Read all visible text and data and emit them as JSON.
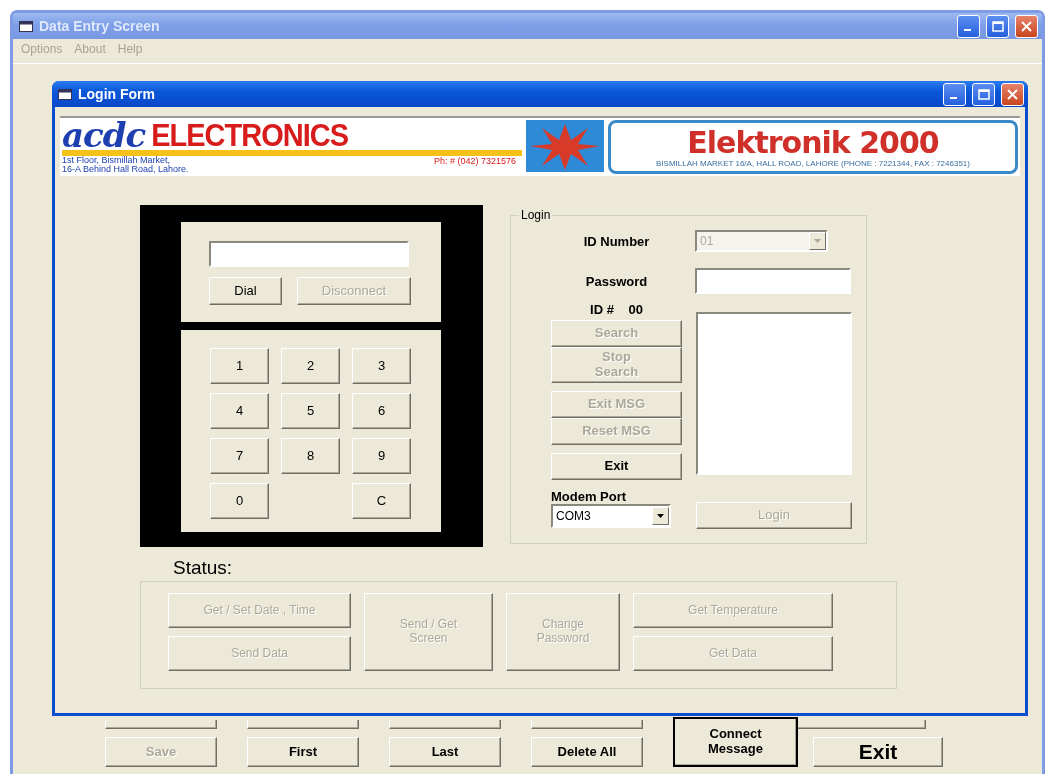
{
  "window": {
    "title": "Data Entry Screen"
  },
  "menu": [
    {
      "label": "Options",
      "disabled": true
    },
    {
      "label": "About",
      "disabled": true
    },
    {
      "label": "Help",
      "disabled": true
    }
  ],
  "login_form": {
    "title": "Login Form",
    "banner": {
      "left_logo": "acdc",
      "left_name": "ELECTRONICS",
      "address_lines": [
        "1st Floor, Bismillah Market,",
        "16-A Behind Hall Road, Lahore."
      ],
      "phone": "Ph: # (042) 7321576",
      "right_name": "Elektronik",
      "right_number": "2000",
      "right_address": "BISMILLAH MARKET 16/A, HALL ROAD, LAHORE (PHONE : 7221344, FAX : 7246351)"
    },
    "dialer": {
      "buttons": [
        {
          "label": "Dial",
          "disabled": false
        },
        {
          "label": "Disconnect",
          "disabled": true
        }
      ],
      "keys": [
        "1",
        "2",
        "3",
        "4",
        "5",
        "6",
        "7",
        "8",
        "9",
        "0",
        "C"
      ]
    },
    "login": {
      "legend": "Login",
      "id_label": "ID Number",
      "id_value": "01",
      "id_disabled": true,
      "password_label": "Password",
      "id_hash_label": "ID #",
      "id_hash_value": "00",
      "buttons": [
        {
          "label": "Search",
          "disabled": true
        },
        {
          "label": "Stop\nSearch",
          "disabled": true
        },
        {
          "label": "Exit MSG",
          "disabled": true
        },
        {
          "label": "Reset MSG",
          "disabled": true
        },
        {
          "label": "Exit",
          "disabled": false
        }
      ],
      "port_label": "Modem Port",
      "port_value": "COM3",
      "login_button": {
        "label": "Login",
        "disabled": true
      }
    },
    "status": {
      "label": "Status:",
      "buttons": [
        {
          "label": "Get / Set Date , Time",
          "disabled": true,
          "kind": "short"
        },
        {
          "label": "Send / Get\nScreen",
          "disabled": true,
          "kind": "tall"
        },
        {
          "label": "Change\nPassword",
          "disabled": true,
          "kind": "tall"
        },
        {
          "label": "Get Temperature",
          "disabled": true,
          "kind": "short"
        },
        {
          "label": "Send Data",
          "disabled": true,
          "kind": "short"
        },
        {
          "label": "Get Data",
          "disabled": true,
          "kind": "short"
        }
      ]
    }
  },
  "bottom_buttons": [
    {
      "label": "Save",
      "disabled": true,
      "kind": "normal"
    },
    {
      "label": "First",
      "disabled": false,
      "kind": "normal"
    },
    {
      "label": "Last",
      "disabled": false,
      "kind": "normal"
    },
    {
      "label": "Delete All",
      "disabled": false,
      "kind": "normal"
    },
    {
      "label": "Connect\nMessage",
      "disabled": false,
      "kind": "tall"
    },
    {
      "label": "Exit",
      "disabled": false,
      "kind": "large"
    }
  ]
}
